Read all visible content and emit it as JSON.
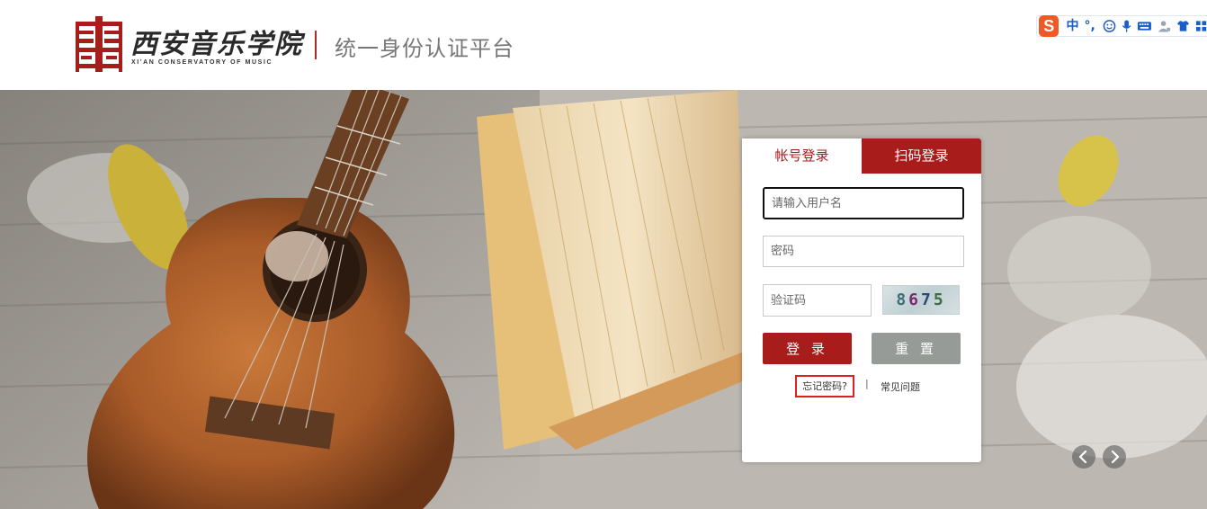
{
  "header": {
    "school_name_cn": "西安音乐学院",
    "school_name_en": "XI'AN CONSERVATORY OF MUSIC",
    "platform_title": "统一身份认证平台",
    "brand_color": "#a81c1c"
  },
  "ime_toolbar": {
    "logo_letter": "S",
    "mode_label": "中",
    "punct_label": "°,",
    "icons": [
      "smiley-icon",
      "microphone-icon",
      "keyboard-icon",
      "user-icon",
      "shirt-icon",
      "grid-icon"
    ]
  },
  "login": {
    "tabs": [
      {
        "label": "帐号登录",
        "active": true
      },
      {
        "label": "扫码登录",
        "active": false
      }
    ],
    "username_placeholder": "请输入用户名",
    "password_placeholder": "密码",
    "captcha_placeholder": "验证码",
    "captcha_text": [
      "8",
      "6",
      "7",
      "5"
    ],
    "login_button": "登 录",
    "reset_button": "重 置",
    "forgot_link": "忘记密码?",
    "separator": "|",
    "faq_link": "常见问题"
  },
  "carousel": {
    "prev_icon": "chevron-left-icon",
    "next_icon": "chevron-right-icon"
  }
}
